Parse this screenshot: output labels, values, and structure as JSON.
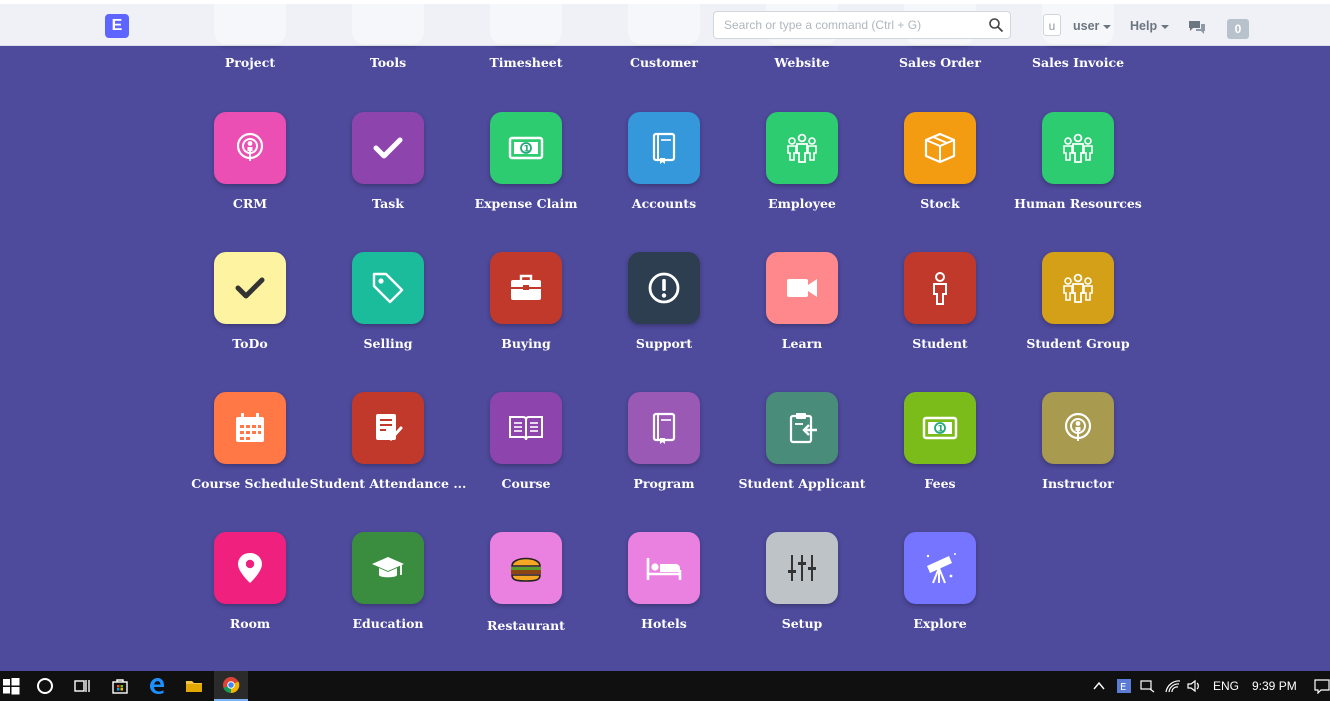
{
  "navbar": {
    "logo_letter": "E",
    "search_placeholder": "Search or type a command (Ctrl + G)",
    "avatar_letter": "u",
    "user_label": "user",
    "help_label": "Help",
    "notification_count": "0"
  },
  "modules_partial_row": [
    "Project",
    "Tools",
    "Timesheet",
    "Customer",
    "Website",
    "Sales Order",
    "Sales Invoice"
  ],
  "modules": [
    {
      "label": "CRM",
      "color": "#ec4fb4",
      "icon": "target-icon"
    },
    {
      "label": "Task",
      "color": "#8e44ad",
      "icon": "check-icon"
    },
    {
      "label": "Expense Claim",
      "color": "#2ecc71",
      "icon": "money-icon"
    },
    {
      "label": "Accounts",
      "color": "#3498db",
      "icon": "book-icon"
    },
    {
      "label": "Employee",
      "color": "#2ecc71",
      "icon": "people-icon"
    },
    {
      "label": "Stock",
      "color": "#f39c12",
      "icon": "box-icon"
    },
    {
      "label": "Human Resources",
      "color": "#2ecc71",
      "icon": "people-icon"
    },
    {
      "label": "ToDo",
      "color": "#fef3a0",
      "icon": "check-icon"
    },
    {
      "label": "Selling",
      "color": "#1abc9c",
      "icon": "tag-icon"
    },
    {
      "label": "Buying",
      "color": "#c0392b",
      "icon": "briefcase-icon"
    },
    {
      "label": "Support",
      "color": "#2c3e50",
      "icon": "alert-icon"
    },
    {
      "label": "Learn",
      "color": "#ff888c",
      "icon": "video-icon"
    },
    {
      "label": "Student",
      "color": "#c0392b",
      "icon": "person-icon"
    },
    {
      "label": "Student Group",
      "color": "#d4a017",
      "icon": "people-icon"
    },
    {
      "label": "Course Schedule",
      "color": "#ff7846",
      "icon": "calendar-icon"
    },
    {
      "label": "Student Attendance ...",
      "color": "#c0392b",
      "icon": "checklist-icon"
    },
    {
      "label": "Course",
      "color": "#8e44ad",
      "icon": "open-book-icon"
    },
    {
      "label": "Program",
      "color": "#9b59b6",
      "icon": "book-icon"
    },
    {
      "label": "Student Applicant",
      "color": "#4a8c7a",
      "icon": "clipboard-icon"
    },
    {
      "label": "Fees",
      "color": "#7cbc1a",
      "icon": "money-icon"
    },
    {
      "label": "Instructor",
      "color": "#a89a4e",
      "icon": "target-icon"
    },
    {
      "label": "Room",
      "color": "#f0217e",
      "icon": "location-icon"
    },
    {
      "label": "Education",
      "color": "#3a8c3f",
      "icon": "graduation-cap-icon"
    },
    {
      "label": "Restaurant",
      "color": "#ea81e0",
      "icon": "burger-icon"
    },
    {
      "label": "Hotels",
      "color": "#ea81e0",
      "icon": "bed-icon"
    },
    {
      "label": "Setup",
      "color": "#bdc3c7",
      "icon": "sliders-icon"
    },
    {
      "label": "Explore",
      "color": "#7575ff",
      "icon": "telescope-icon"
    }
  ],
  "taskbar": {
    "language": "ENG",
    "time": "9:39 PM"
  }
}
